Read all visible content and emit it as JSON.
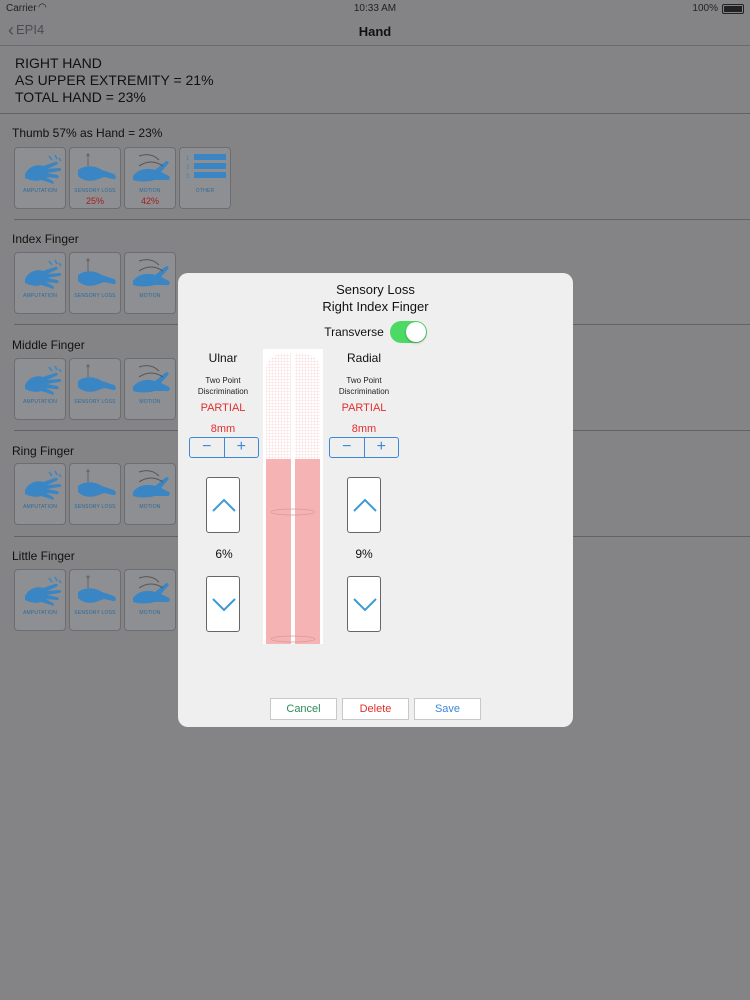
{
  "status_bar": {
    "carrier": "Carrier",
    "time": "10:33 AM",
    "battery": "100%"
  },
  "nav": {
    "back_label": "EPI4",
    "title": "Hand"
  },
  "summary": {
    "line1": "RIGHT HAND",
    "line2": "AS UPPER EXTREMITY = 21%",
    "line3": "TOTAL HAND = 23%"
  },
  "sections": [
    {
      "title": "Thumb  57%  as Hand = 23%",
      "tiles": [
        {
          "caption": "AMPUTATION",
          "pct": ""
        },
        {
          "caption": "SENSORY LOSS",
          "pct": "25%"
        },
        {
          "caption": "MOTION",
          "pct": "42%"
        },
        {
          "caption": "OTHER",
          "pct": ""
        }
      ]
    },
    {
      "title": "Index Finger",
      "tiles": [
        {
          "caption": "AMPUTATION",
          "pct": ""
        },
        {
          "caption": "SENSORY LOSS",
          "pct": ""
        },
        {
          "caption": "MOTION",
          "pct": ""
        }
      ]
    },
    {
      "title": "Middle Finger",
      "tiles": [
        {
          "caption": "AMPUTATION",
          "pct": ""
        },
        {
          "caption": "SENSORY LOSS",
          "pct": ""
        },
        {
          "caption": "MOTION",
          "pct": ""
        }
      ]
    },
    {
      "title": "Ring Finger",
      "tiles": [
        {
          "caption": "AMPUTATION",
          "pct": ""
        },
        {
          "caption": "SENSORY LOSS",
          "pct": ""
        },
        {
          "caption": "MOTION",
          "pct": ""
        }
      ]
    },
    {
      "title": "Little Finger",
      "tiles": [
        {
          "caption": "AMPUTATION",
          "pct": ""
        },
        {
          "caption": "SENSORY LOSS",
          "pct": ""
        },
        {
          "caption": "MOTION",
          "pct": ""
        }
      ]
    }
  ],
  "modal": {
    "title_line1": "Sensory Loss",
    "title_line2": "Right Index Finger",
    "toggle_label": "Transverse",
    "toggle_on": true,
    "ulnar": {
      "header": "Ulnar",
      "desc_line1": "Two Point",
      "desc_line2": "Discrimination",
      "status": "PARTIAL",
      "mm": "8mm",
      "percent": "6%"
    },
    "radial": {
      "header": "Radial",
      "desc_line1": "Two Point",
      "desc_line2": "Discrimination",
      "status": "PARTIAL",
      "mm": "8mm",
      "percent": "9%"
    },
    "stepper_minus": "−",
    "stepper_plus": "+",
    "buttons": {
      "cancel": "Cancel",
      "delete": "Delete",
      "save": "Save"
    },
    "colors": {
      "cancel": "#2e8b57",
      "delete": "#e0302d",
      "save": "#3d87d8",
      "affected": "#f6b3b3"
    }
  }
}
